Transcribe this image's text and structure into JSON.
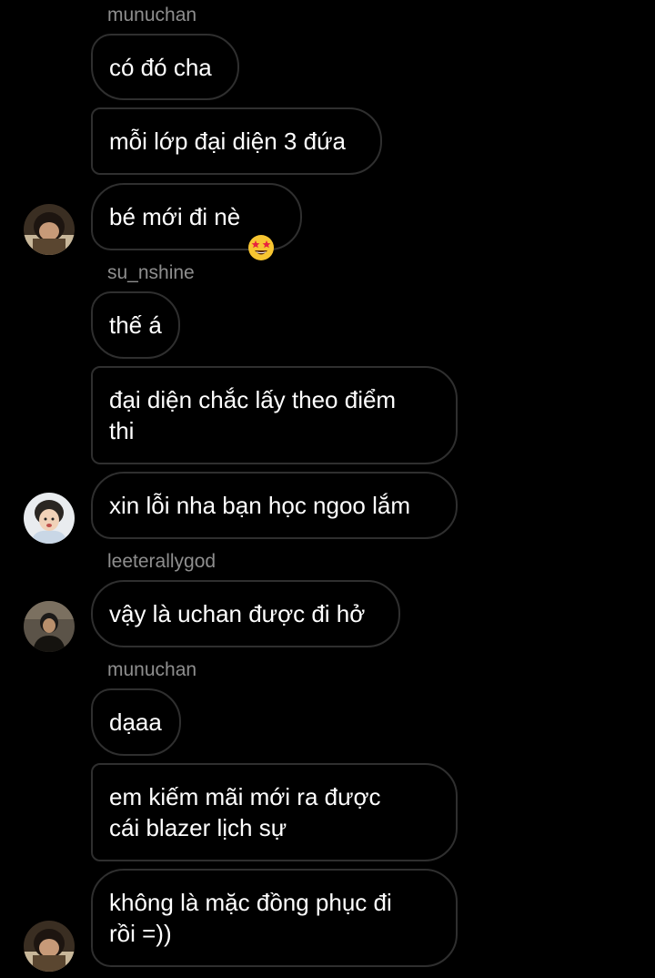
{
  "messages": [
    {
      "sender": "munuchan"
    },
    {
      "text": "có đó cha"
    },
    {
      "text": "mỗi lớp đại diện 3 đứa"
    },
    {
      "text": "bé mới đi nè",
      "emoji": "star-struck-emoji"
    },
    {
      "sender": "su_nshine"
    },
    {
      "text": "thế á"
    },
    {
      "text": "đại diện chắc lấy theo điểm\nthi"
    },
    {
      "text": "xin lỗi nha bạn học ngoo lắm"
    },
    {
      "sender": "leeterallygod"
    },
    {
      "text": "vậy là uchan được đi hở"
    },
    {
      "sender": "munuchan"
    },
    {
      "text": "dạaa"
    },
    {
      "text": "em kiếm mãi mới ra được\ncái blazer lịch sự"
    },
    {
      "text": "không là mặc đồng phục đi\nrồi =))"
    }
  ],
  "avatars": {
    "munuchan": "avatar-photo-munuchan",
    "su_nshine": "avatar-photo-su_nshine",
    "leeterallygod": "avatar-photo-leeterallygod"
  },
  "colors": {
    "background": "#000000",
    "bubble_border": "#2f2f2f",
    "sender_name": "#8e8e8e",
    "text": "#ffffff"
  }
}
